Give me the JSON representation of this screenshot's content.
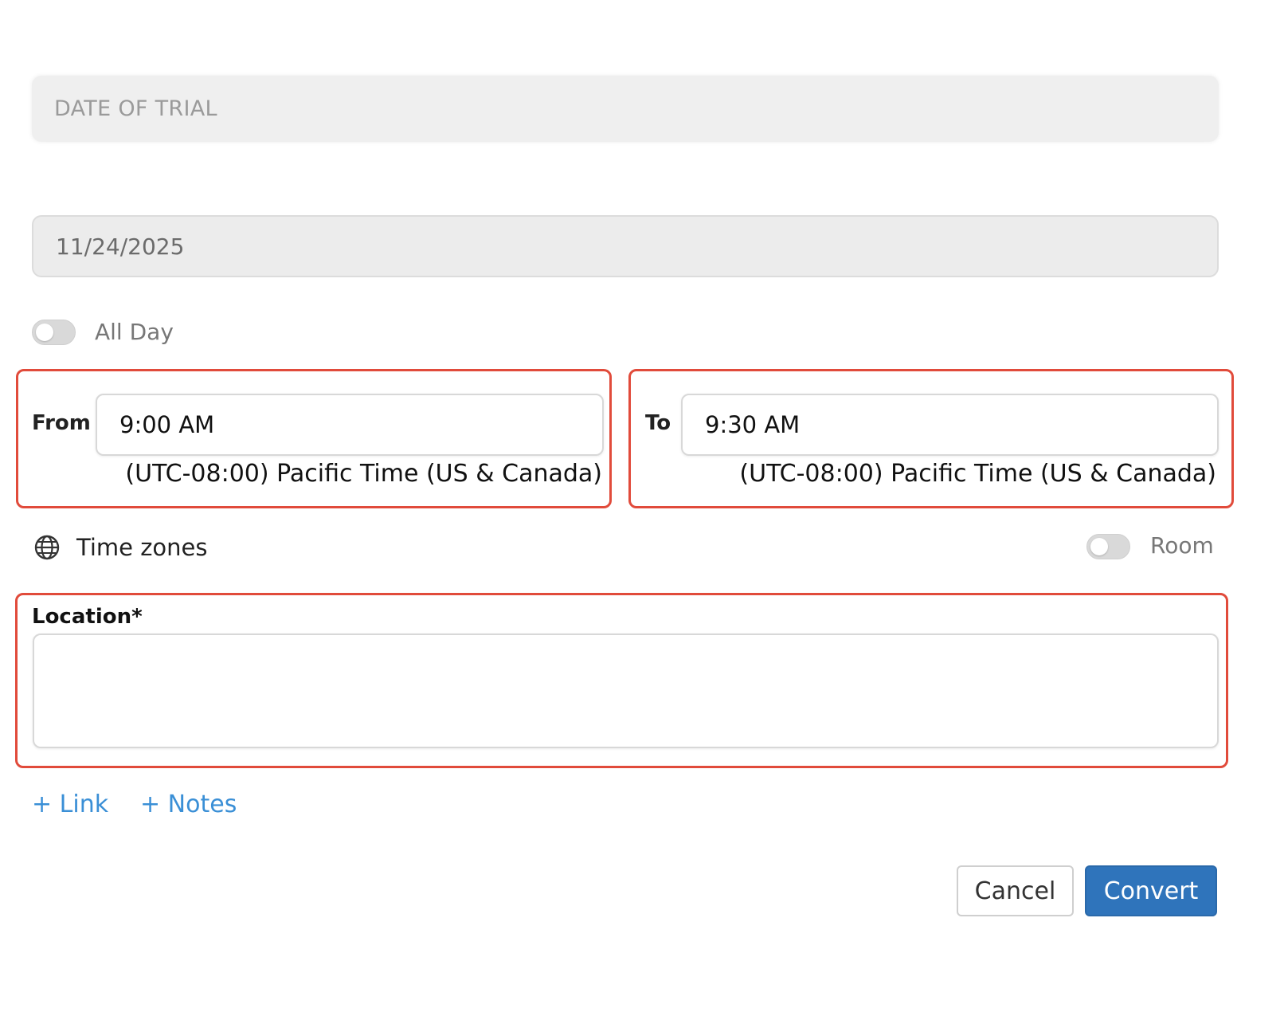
{
  "form": {
    "title_placeholder": "DATE OF TRIAL",
    "date_value": "11/24/2025",
    "all_day_label": "All Day",
    "from": {
      "label": "From",
      "time": "9:00 AM",
      "timezone": "(UTC-08:00) Pacific Time (US & Canada)"
    },
    "to": {
      "label": "To",
      "time": "9:30 AM",
      "timezone": "(UTC-08:00) Pacific Time (US & Canada)"
    },
    "time_zones_label": "Time zones",
    "room_label": "Room",
    "location_label": "Location*",
    "location_value": "",
    "add_link": "+ Link",
    "add_notes": "+ Notes"
  },
  "actions": {
    "cancel": "Cancel",
    "convert": "Convert"
  },
  "icons": {
    "time_zones": "globe-icon"
  },
  "colors": {
    "highlight_border": "#e14b3b",
    "primary_button": "#2f74bb",
    "link": "#3a8fd6"
  }
}
